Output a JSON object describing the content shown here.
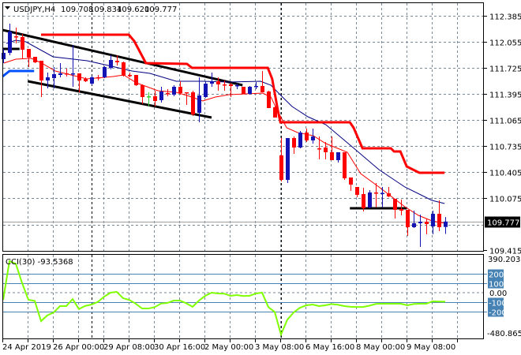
{
  "header": {
    "symbol": "USDJPY,H4",
    "open": "109.708",
    "high": "109.834",
    "low": "109.620",
    "close": "109.777"
  },
  "indicator": {
    "label": "CCI(30) -93.5368"
  },
  "price_axis": {
    "labels": [
      "112.385",
      "112.055",
      "111.725",
      "111.395",
      "111.065",
      "110.735",
      "110.405",
      "110.075",
      "109.415"
    ],
    "current_price": "109.777"
  },
  "cci_axis": {
    "max_label": "390.2031",
    "min_label": "-480.8651",
    "zero_label": "0.00",
    "levels": [
      "200",
      "100",
      "-100",
      "-200"
    ]
  },
  "time_axis": {
    "labels": [
      "24 Apr 2019",
      "26 Apr 00:00",
      "29 Apr 08:00",
      "30 Apr 16:00",
      "2 May 00:00",
      "3 May 08:00",
      "6 May 16:00",
      "8 May 00:00",
      "9 May 08:00"
    ]
  },
  "colors": {
    "bull": "#1414b4",
    "bear": "#ff0000",
    "doji": "#33cc33",
    "fast_ma": "#ff0000",
    "slow_ma": "#000080",
    "stop_line": "#ff0000",
    "cci": "#7fff00",
    "level": "#4682b4"
  },
  "chart_data": {
    "type": "candlestick",
    "title": "USDJPY,H4",
    "ylim": [
      109.415,
      112.415
    ],
    "ohlc": [
      [
        111.835,
        111.965,
        111.785,
        111.915
      ],
      [
        111.915,
        112.285,
        111.885,
        112.185
      ],
      [
        112.125,
        112.235,
        112.035,
        112.115
      ],
      [
        112.115,
        112.155,
        111.835,
        111.955
      ],
      [
        111.965,
        111.965,
        111.735,
        111.855
      ],
      [
        111.865,
        111.865,
        111.785,
        111.795
      ],
      [
        111.815,
        111.815,
        111.355,
        111.565
      ],
      [
        111.565,
        111.665,
        111.465,
        111.605
      ],
      [
        111.595,
        111.735,
        111.465,
        111.645
      ],
      [
        111.635,
        111.785,
        111.605,
        111.655
      ],
      [
        111.655,
        111.715,
        111.615,
        111.65
      ],
      [
        111.645,
        112.015,
        111.485,
        111.655
      ],
      [
        111.655,
        111.655,
        111.415,
        111.565
      ],
      [
        111.585,
        111.605,
        111.545,
        111.555
      ],
      [
        111.525,
        111.625,
        111.505,
        111.605
      ],
      [
        111.605,
        111.635,
        111.565,
        111.6
      ],
      [
        111.605,
        111.745,
        111.595,
        111.735
      ],
      [
        111.725,
        111.885,
        111.705,
        111.825
      ],
      [
        111.815,
        111.885,
        111.755,
        111.795
      ],
      [
        111.795,
        111.805,
        111.615,
        111.625
      ],
      [
        111.635,
        111.665,
        111.605,
        111.63
      ],
      [
        111.635,
        111.635,
        111.495,
        111.505
      ],
      [
        111.505,
        111.515,
        111.265,
        111.355
      ],
      [
        111.365,
        111.415,
        111.235,
        111.365
      ],
      [
        111.365,
        111.435,
        111.235,
        111.305
      ],
      [
        111.315,
        111.485,
        111.285,
        111.425
      ],
      [
        111.405,
        111.455,
        111.365,
        111.4
      ],
      [
        111.385,
        111.505,
        111.365,
        111.485
      ],
      [
        111.485,
        111.555,
        111.385,
        111.405
      ],
      [
        111.415,
        111.415,
        111.255,
        111.41
      ],
      [
        111.415,
        111.435,
        111.115,
        111.135
      ],
      [
        111.155,
        111.605,
        111.035,
        111.375
      ],
      [
        111.355,
        111.555,
        111.345,
        111.525
      ],
      [
        111.525,
        111.665,
        111.485,
        111.555
      ],
      [
        111.555,
        111.605,
        111.435,
        111.515
      ],
      [
        111.515,
        111.565,
        111.435,
        111.51
      ],
      [
        111.515,
        111.535,
        111.355,
        111.495
      ],
      [
        111.5,
        111.525,
        111.455,
        111.505
      ],
      [
        111.485,
        111.485,
        111.395,
        111.395
      ],
      [
        111.395,
        111.495,
        111.385,
        111.485
      ],
      [
        111.49,
        111.545,
        111.455,
        111.495
      ],
      [
        111.495,
        111.685,
        111.415,
        111.415
      ],
      [
        111.425,
        111.435,
        111.215,
        111.215
      ],
      [
        111.225,
        111.235,
        111.095,
        111.095
      ],
      [
        110.615,
        110.835,
        110.285,
        110.305
      ],
      [
        110.305,
        110.835,
        110.265,
        110.835
      ],
      [
        110.835,
        110.855,
        110.635,
        110.715
      ],
      [
        110.715,
        110.925,
        110.705,
        110.905
      ],
      [
        110.905,
        110.955,
        110.785,
        110.805
      ],
      [
        110.805,
        110.955,
        110.765,
        110.855
      ],
      [
        110.705,
        110.855,
        110.565,
        110.7
      ],
      [
        110.715,
        110.785,
        110.565,
        110.655
      ],
      [
        110.655,
        110.855,
        110.555,
        110.555
      ],
      [
        110.555,
        110.655,
        110.525,
        110.655
      ],
      [
        110.655,
        110.655,
        110.305,
        110.325
      ],
      [
        110.335,
        110.335,
        110.165,
        110.245
      ],
      [
        110.215,
        110.215,
        110.085,
        110.115
      ],
      [
        110.125,
        110.205,
        109.905,
        109.945
      ],
      [
        109.955,
        110.175,
        109.945,
        110.145
      ],
      [
        110.145,
        110.265,
        109.955,
        110.14
      ],
      [
        110.135,
        110.215,
        109.955,
        110.14
      ],
      [
        110.135,
        110.215,
        110.085,
        110.095
      ],
      [
        110.065,
        110.065,
        109.815,
        109.925
      ],
      [
        109.935,
        110.055,
        109.855,
        109.915
      ],
      [
        109.925,
        109.925,
        109.595,
        109.705
      ],
      [
        109.705,
        109.915,
        109.695,
        109.755
      ],
      [
        109.755,
        109.865,
        109.455,
        109.775
      ],
      [
        109.775,
        109.815,
        109.615,
        109.745
      ],
      [
        109.715,
        109.915,
        109.615,
        109.875
      ],
      [
        109.875,
        110.045,
        109.655,
        109.705
      ],
      [
        109.708,
        109.834,
        109.62,
        109.777
      ]
    ],
    "neutral_bars": [
      23
    ],
    "fast_ma": [
      [
        0.1,
        111.785
      ],
      [
        2,
        111.835
      ],
      [
        4.5,
        111.845
      ],
      [
        6.1,
        111.785
      ],
      [
        8.25,
        111.685
      ],
      [
        10.75,
        111.635
      ],
      [
        13.25,
        111.585
      ],
      [
        17.4,
        111.615
      ],
      [
        19.1,
        111.635
      ],
      [
        21.1,
        111.535
      ],
      [
        24.5,
        111.435
      ],
      [
        27.4,
        111.415
      ],
      [
        29.5,
        111.365
      ],
      [
        31.6,
        111.305
      ],
      [
        33.6,
        111.355
      ],
      [
        35.75,
        111.385
      ],
      [
        41.1,
        111.405
      ],
      [
        42.4,
        111.355
      ],
      [
        43.6,
        111.155
      ],
      [
        44.9,
        110.965
      ],
      [
        46.6,
        110.905
      ],
      [
        49.1,
        110.865
      ],
      [
        51.1,
        110.765
      ],
      [
        54.5,
        110.655
      ],
      [
        56.6,
        110.385
      ],
      [
        59.5,
        110.215
      ],
      [
        63.6,
        109.965
      ],
      [
        65.75,
        109.855
      ],
      [
        67.9,
        109.785
      ],
      [
        69.9,
        109.755
      ]
    ],
    "slow_ma": [
      [
        0.5,
        112.035
      ],
      [
        2,
        112.075
      ],
      [
        3.6,
        112.055
      ],
      [
        7.9,
        111.865
      ],
      [
        13.3,
        111.815
      ],
      [
        16.1,
        111.765
      ],
      [
        20.4,
        111.685
      ],
      [
        23.25,
        111.655
      ],
      [
        27.4,
        111.555
      ],
      [
        31.6,
        111.555
      ],
      [
        35.75,
        111.545
      ],
      [
        40.75,
        111.555
      ],
      [
        42.4,
        111.505
      ],
      [
        44.1,
        111.365
      ],
      [
        45.75,
        111.235
      ],
      [
        48.25,
        111.105
      ],
      [
        51.1,
        111.005
      ],
      [
        55.4,
        110.715
      ],
      [
        59.5,
        110.435
      ],
      [
        63.6,
        110.215
      ],
      [
        67.9,
        110.045
      ],
      [
        69.9,
        110.005
      ]
    ],
    "stop_line": [
      [
        6,
        112.145
      ],
      [
        19.9,
        112.145
      ],
      [
        20.75,
        112.065
      ],
      [
        22.6,
        111.785
      ],
      [
        29.1,
        111.775
      ],
      [
        29.9,
        111.725
      ],
      [
        41.9,
        111.725
      ],
      [
        42.6,
        111.585
      ],
      [
        43.5,
        111.185
      ],
      [
        43.9,
        111.035
      ],
      [
        54.9,
        111.035
      ],
      [
        55.5,
        110.965
      ],
      [
        56.9,
        110.705
      ],
      [
        61.4,
        110.705
      ],
      [
        61.9,
        110.665
      ],
      [
        62.9,
        110.665
      ],
      [
        63.9,
        110.475
      ],
      [
        64.9,
        110.435
      ],
      [
        65.9,
        110.395
      ],
      [
        69.9,
        110.395
      ]
    ],
    "early_band": [
      [
        -0.1,
        111.615
      ],
      [
        1,
        111.685
      ],
      [
        4.9,
        111.685
      ]
    ],
    "trendlines": [
      [
        [
          -0.1,
          112.205
        ],
        [
          37.9,
          111.505
        ]
      ],
      [
        [
          3.9,
          111.555
        ],
        [
          33,
          111.095
        ]
      ],
      [
        [
          -0.1,
          111.965
        ],
        [
          2.6,
          111.965
        ]
      ],
      [
        [
          54.9,
          109.945
        ],
        [
          63.9,
          109.945
        ]
      ]
    ],
    "cci": {
      "period": 30,
      "ylim": [
        -480.8651,
        390.2031
      ],
      "levels": [
        200,
        100,
        -100,
        -200
      ],
      "values": [
        -74,
        328,
        300,
        100,
        -74,
        -85,
        -295,
        -235,
        -205,
        -139,
        -139,
        -66,
        -170,
        -137,
        -123,
        -95,
        -41,
        0,
        8,
        -57,
        -76,
        -115,
        -164,
        -164,
        -150,
        -113,
        -107,
        -82,
        -82,
        -110,
        -146,
        -82,
        -33,
        0,
        -8,
        -10,
        -33,
        -25,
        -35,
        -33,
        -8,
        0,
        -150,
        -200,
        -434,
        -280,
        -205,
        -156,
        -131,
        -123,
        -139,
        -131,
        -118,
        -125,
        -139,
        -146,
        -148,
        -148,
        -135,
        -117,
        -115,
        -115,
        -115,
        -115,
        -131,
        -118,
        -115,
        -115,
        -90,
        -92,
        -93.5368
      ]
    }
  }
}
